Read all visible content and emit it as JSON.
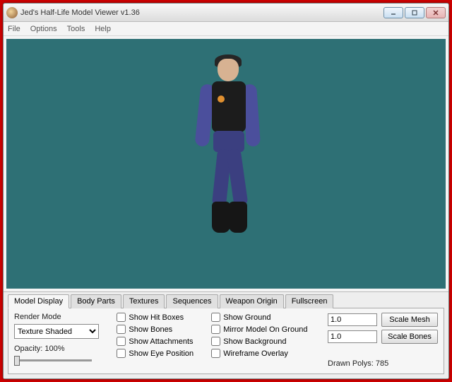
{
  "window": {
    "title": "Jed's Half-Life Model Viewer v1.36"
  },
  "menu": {
    "file": "File",
    "options": "Options",
    "tools": "Tools",
    "help": "Help"
  },
  "tabs": {
    "model_display": "Model Display",
    "body_parts": "Body Parts",
    "textures": "Textures",
    "sequences": "Sequences",
    "weapon_origin": "Weapon Origin",
    "fullscreen": "Fullscreen"
  },
  "model_display": {
    "render_mode_label": "Render Mode",
    "render_mode_value": "Texture Shaded",
    "opacity_label": "Opacity: 100%",
    "checks": {
      "hitboxes": "Show Hit Boxes",
      "bones": "Show Bones",
      "attachments": "Show Attachments",
      "eyepos": "Show Eye Position",
      "ground": "Show Ground",
      "mirror": "Mirror Model On Ground",
      "background": "Show Background",
      "wireframe": "Wireframe Overlay"
    },
    "scale_mesh_value": "1.0",
    "scale_mesh_btn": "Scale Mesh",
    "scale_bones_value": "1.0",
    "scale_bones_btn": "Scale Bones",
    "drawn_polys": "Drawn Polys: 785"
  }
}
